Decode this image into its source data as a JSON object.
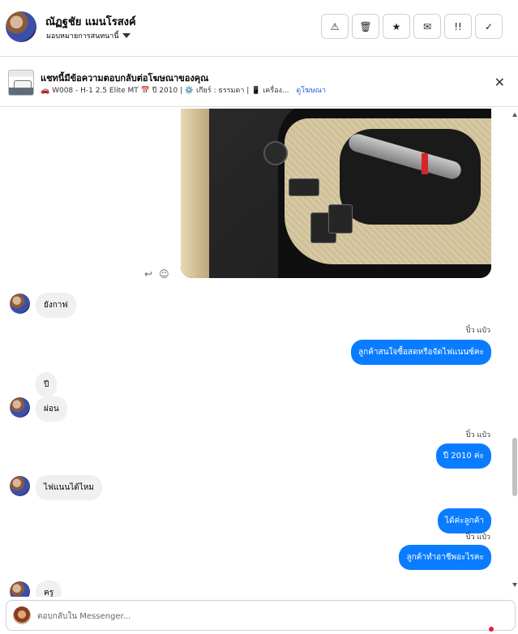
{
  "header": {
    "contact_name": "ณัฏฐชัย แมนโรสงค์",
    "assign_label": "มอบหมายการสนทนานี้",
    "actions": [
      {
        "icon": "warning-icon",
        "glyph": "⚠"
      },
      {
        "icon": "trash-icon",
        "glyph": "🗑"
      },
      {
        "icon": "star-icon",
        "glyph": "★"
      },
      {
        "icon": "mail-icon",
        "glyph": "✉"
      },
      {
        "icon": "follow-up-icon",
        "glyph": "!!"
      },
      {
        "icon": "checkmark-icon",
        "glyph": "✓"
      }
    ]
  },
  "banner": {
    "title": "แชทนี้มีข้อความตอบกลับต่อโฆษณาของคุณ",
    "subtitle": "🚗 W008 - H-1 2.5 Elite MT 📅 ปี 2010 | ⚙️ เกียร์ : ธรรมดา | 📱 เครื่อง...",
    "link": "ดูโฆษณา",
    "close": "✕"
  },
  "photo_tools": {
    "reply": "↩",
    "react": "☺"
  },
  "messages": [
    {
      "side": "in",
      "text": "ยังกาฟ"
    },
    {
      "side": "out",
      "sender": "ปิ๋ว แป๋ว",
      "text": "ลูกค้าสนใจซื้อสดหรือจัดไฟแนนซ์คะ"
    },
    {
      "side": "in",
      "text": "ปี"
    },
    {
      "side": "in",
      "text": "ผ่อน"
    },
    {
      "side": "out",
      "sender": "ปิ๋ว แป๋ว",
      "text": "ปี 2010 ค่ะ"
    },
    {
      "side": "in",
      "text": "ไฟแนนได้ไหม"
    },
    {
      "side": "out",
      "text": "ได้ค่ะลูกค้า"
    },
    {
      "side": "out",
      "sender": "ปิ๋ว แป๋ว",
      "text": "ลูกค้าทำอาชีพอะไรคะ"
    },
    {
      "side": "in",
      "text": "ครู"
    }
  ],
  "composer": {
    "placeholder": "ตอบกลับใน Messenger..."
  }
}
